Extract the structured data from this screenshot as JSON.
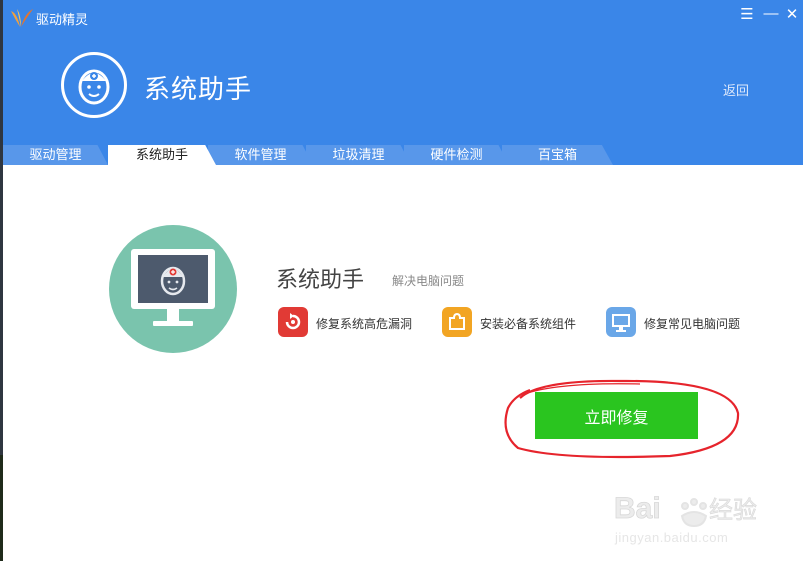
{
  "app": {
    "title": "驱动精灵"
  },
  "window_controls": {
    "menu": "☰",
    "minimize": "—",
    "close": "✕"
  },
  "header": {
    "title": "系统助手",
    "back_label": "返回"
  },
  "tabs": [
    {
      "label": "驱动管理",
      "active": false
    },
    {
      "label": "系统助手",
      "active": true
    },
    {
      "label": "软件管理",
      "active": false
    },
    {
      "label": "垃圾清理",
      "active": false
    },
    {
      "label": "硬件检测",
      "active": false
    },
    {
      "label": "百宝箱",
      "active": false
    }
  ],
  "main": {
    "title": "系统助手",
    "subtitle": "解决电脑问题",
    "features": [
      {
        "label": "修复系统高危漏洞",
        "icon": "shield-refresh-icon",
        "color": "#e13a35"
      },
      {
        "label": "安装必备系统组件",
        "icon": "puzzle-icon",
        "color": "#f2a523"
      },
      {
        "label": "修复常见电脑问题",
        "icon": "monitor-icon",
        "color": "#6aa7e8"
      }
    ],
    "repair_button": "立即修复"
  },
  "watermark": {
    "brand": "Baidu经验",
    "url": "jingyan.baidu.com"
  },
  "colors": {
    "header": "#3a86e8",
    "tab": "#5897ea",
    "button": "#2ac51f",
    "highlight": "#e6242c",
    "illustration": "#7ac4ad"
  }
}
